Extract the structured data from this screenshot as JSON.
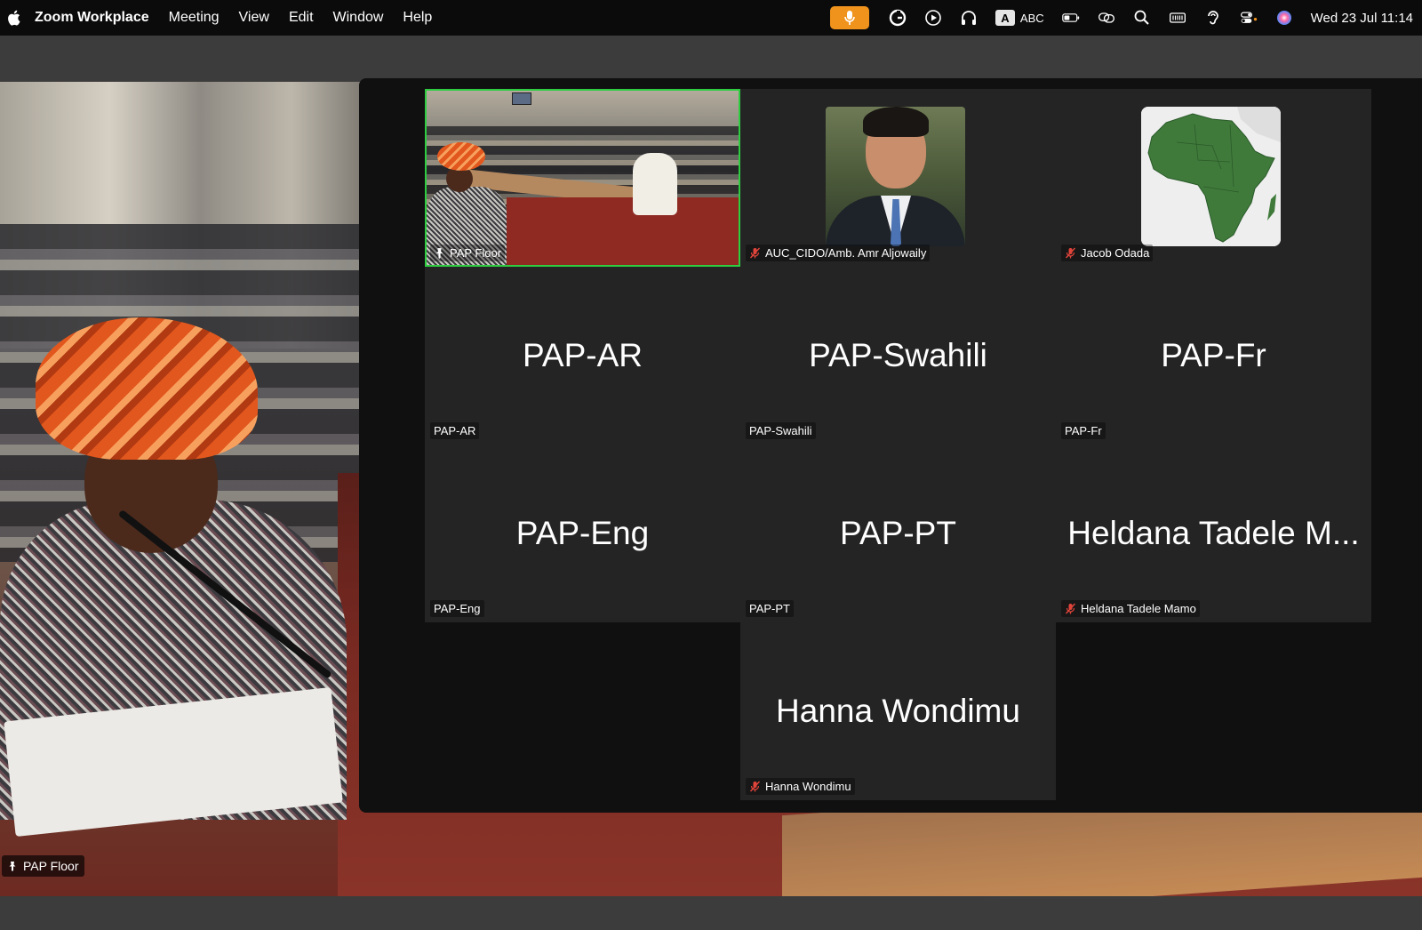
{
  "menubar": {
    "app_name": "Zoom Workplace",
    "menus": [
      "Meeting",
      "View",
      "Edit",
      "Window",
      "Help"
    ],
    "input_source": "ABC",
    "input_source_badge": "A",
    "clock": "Wed 23 Jul  11:14",
    "mic_color": "#f0931d"
  },
  "background_video": {
    "label": "PAP Floor"
  },
  "gallery": {
    "tiles": [
      {
        "name": "PAP Floor",
        "display_name": "",
        "type": "video",
        "muted": false,
        "pinned": true,
        "active_speaker": true
      },
      {
        "name": "AUC_CIDO/Amb. Amr Aljowaily",
        "display_name": "",
        "type": "photo",
        "muted": true
      },
      {
        "name": "Jacob Odada",
        "display_name": "",
        "type": "map",
        "muted": true
      },
      {
        "name": "PAP-AR",
        "display_name": "PAP-AR",
        "type": "name",
        "muted": false
      },
      {
        "name": "PAP-Swahili",
        "display_name": "PAP-Swahili",
        "type": "name",
        "muted": false
      },
      {
        "name": "PAP-Fr",
        "display_name": "PAP-Fr",
        "type": "name",
        "muted": false
      },
      {
        "name": "PAP-Eng",
        "display_name": "PAP-Eng",
        "type": "name",
        "muted": false
      },
      {
        "name": "PAP-PT",
        "display_name": "PAP-PT",
        "type": "name",
        "muted": false
      },
      {
        "name": "Heldana Tadele Mamo",
        "display_name": "Heldana Tadele M...",
        "type": "name",
        "muted": true
      },
      {
        "name": "Hanna Wondimu",
        "display_name": "Hanna Wondimu",
        "type": "name",
        "muted": true
      }
    ],
    "active_border_color": "#2ecc40",
    "muted_icon_color": "#e0443a"
  }
}
